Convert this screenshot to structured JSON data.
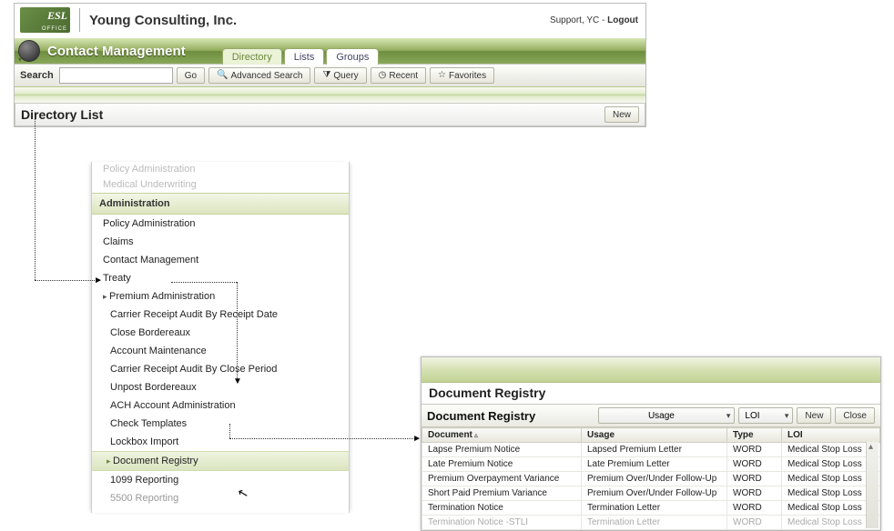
{
  "header": {
    "company": "Young Consulting, Inc.",
    "user": "Support, YC",
    "logout": "Logout",
    "module": "Contact Management",
    "tabs": [
      "Directory",
      "Lists",
      "Groups"
    ],
    "search_label": "Search",
    "search_placeholder": "",
    "buttons": {
      "go": "Go",
      "adv": "Advanced Search",
      "query": "Query",
      "recent": "Recent",
      "fav": "Favorites"
    },
    "page_title": "Directory List",
    "new": "New"
  },
  "menu": {
    "faded": [
      "Policy Administration",
      "Medical Underwriting"
    ],
    "section": "Administration",
    "items": [
      "Policy Administration",
      "Claims",
      "Contact Management",
      "Treaty"
    ],
    "expanded": "Premium Administration",
    "subs": [
      "Carrier Receipt Audit By Receipt Date",
      "Close Bordereaux",
      "Account Maintenance",
      "Carrier Receipt Audit By Close Period",
      "Unpost Bordereaux",
      "ACH Account Administration",
      "Check Templates",
      "Lockbox Import"
    ],
    "active": "Document Registry",
    "after": [
      "1099 Reporting",
      "5500 Reporting"
    ]
  },
  "registry": {
    "title_big": "Document Registry",
    "title_bar": "Document Registry",
    "usage_sel": "Usage",
    "loi_sel": "LOI",
    "new": "New",
    "close": "Close",
    "cols": [
      "Document",
      "Usage",
      "Type",
      "LOI"
    ],
    "rows": [
      [
        "Lapse Premium Notice",
        "Lapsed Premium Letter",
        "WORD",
        "Medical Stop Loss"
      ],
      [
        "Late Premium Notice",
        "Late Premium Letter",
        "WORD",
        "Medical Stop Loss"
      ],
      [
        "Premium Overpayment Variance",
        "Premium Over/Under Follow-Up",
        "WORD",
        "Medical Stop Loss"
      ],
      [
        "Short Paid Premium Variance",
        "Premium Over/Under Follow-Up",
        "WORD",
        "Medical Stop Loss"
      ],
      [
        "Termination Notice",
        "Termination Letter",
        "WORD",
        "Medical Stop Loss"
      ],
      [
        "Termination Notice -STLI",
        "Termination Letter",
        "WORD",
        "Medical Stop Loss"
      ]
    ]
  }
}
